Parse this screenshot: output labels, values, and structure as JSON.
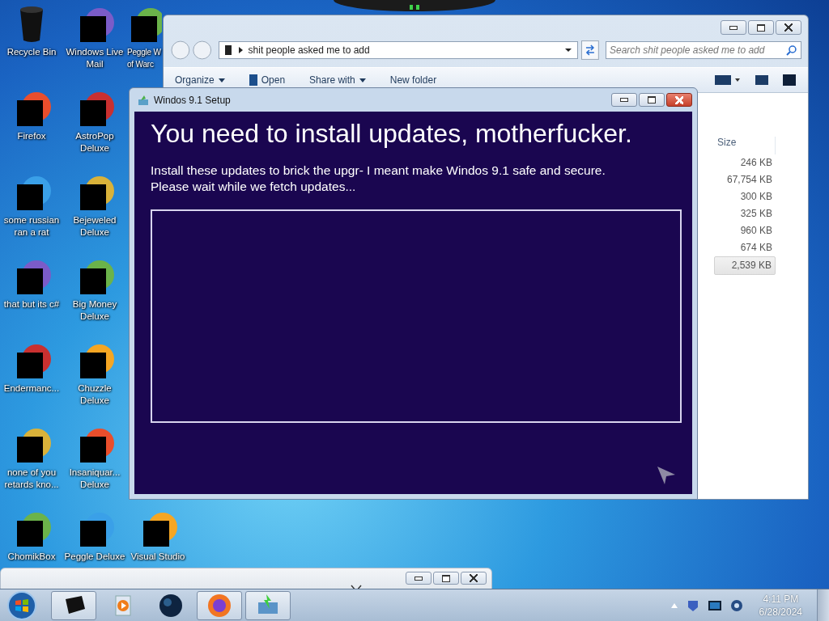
{
  "desktop": {
    "columns": [
      [
        {
          "label": "Recycle Bin",
          "redacted": false
        },
        {
          "label": "Firefox",
          "redacted": true
        },
        {
          "label": "some russian ran a rat",
          "redacted": true
        },
        {
          "label": "that but its c#",
          "redacted": true
        },
        {
          "label": "Endermanc...",
          "redacted": true
        },
        {
          "label": "none of you retards kno...",
          "redacted": true
        },
        {
          "label": "ChomikBox",
          "redacted": true
        }
      ],
      [
        {
          "label": "Windows Live Mail",
          "redacted": true
        },
        {
          "label": "AstroPop Deluxe",
          "redacted": true
        },
        {
          "label": "Bejeweled Deluxe",
          "redacted": true
        },
        {
          "label": "Big Money Deluxe",
          "redacted": true
        },
        {
          "label": "Chuzzle Deluxe",
          "redacted": true
        },
        {
          "label": "Insaniquar... Deluxe",
          "redacted": true
        },
        {
          "label": "Peggle Deluxe",
          "redacted": true
        }
      ],
      [
        {
          "label": "Peggle W\nof Warc",
          "redacted": true
        },
        {
          "label": "Visual Studio",
          "redacted": true
        }
      ]
    ]
  },
  "explorer": {
    "address": "shit people asked me to add",
    "search": {
      "placeholder": "Search shit people asked me to add"
    },
    "toolbar": [
      {
        "label": "Organize",
        "dropdown": true,
        "icon": false
      },
      {
        "label": "Open",
        "dropdown": false,
        "icon": true
      },
      {
        "label": "Share with",
        "dropdown": true,
        "icon": false
      },
      {
        "label": "New folder",
        "dropdown": false,
        "icon": false
      }
    ],
    "size_column": {
      "header": "Size",
      "rows": [
        {
          "value": "246 KB",
          "selected": false
        },
        {
          "value": "67,754 KB",
          "selected": false
        },
        {
          "value": "300 KB",
          "selected": false
        },
        {
          "value": "325 KB",
          "selected": false
        },
        {
          "value": "960 KB",
          "selected": false
        },
        {
          "value": "674 KB",
          "selected": false
        },
        {
          "value": "2,539 KB",
          "selected": true
        }
      ]
    }
  },
  "setup": {
    "title": "Windos 9.1 Setup",
    "heading": "You need to install updates, motherfucker.",
    "lines": [
      "Install these updates to brick the upgr- I meant make Windos 9.1 safe and secure.",
      "Please wait while we fetch updates..."
    ]
  },
  "taskbar": {
    "buttons": [
      {
        "open": true
      },
      {
        "open": false
      },
      {
        "open": false
      },
      {
        "open": true
      },
      {
        "open": true
      }
    ],
    "clock": {
      "time": "4:11 PM",
      "date": "6/28/2024"
    }
  }
}
